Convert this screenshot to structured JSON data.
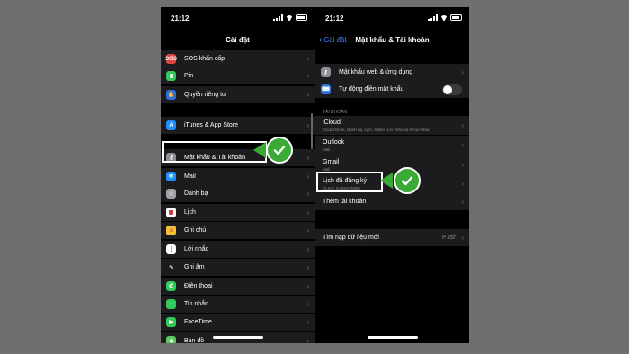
{
  "left_phone": {
    "status": {
      "time": "21:12"
    },
    "title": "Cài đặt",
    "rows": [
      {
        "label": "SOS khẩn cấp",
        "icon": "sos-icon",
        "glyph": "SOS",
        "color": "#e0463d"
      },
      {
        "label": "Pin",
        "icon": "battery-icon",
        "glyph": "▮",
        "color": "#34c759"
      },
      {
        "label": "Quyền riêng tư",
        "icon": "hand-icon",
        "glyph": "✋",
        "color": "#2f6fe0"
      },
      {
        "label": "iTunes & App Store",
        "icon": "app-store-icon",
        "glyph": "A",
        "color": "#1e90ff"
      },
      {
        "label": "Mật khẩu & Tài khoản",
        "icon": "key-icon",
        "glyph": "⚷",
        "color": "#8e8e93"
      },
      {
        "label": "Mail",
        "icon": "mail-icon",
        "glyph": "✉",
        "color": "#1e90ff"
      },
      {
        "label": "Danh bạ",
        "icon": "contacts-icon",
        "glyph": "☺",
        "color": "#a0a0a5"
      },
      {
        "label": "Lịch",
        "icon": "calendar-icon",
        "glyph": "▦",
        "color": "#ffffff"
      },
      {
        "label": "Ghi chú",
        "icon": "notes-icon",
        "glyph": "≡",
        "color": "#f2c233"
      },
      {
        "label": "Lời nhắc",
        "icon": "reminders-icon",
        "glyph": "⋮",
        "color": "#ffffff"
      },
      {
        "label": "Ghi âm",
        "icon": "voice-memos-icon",
        "glyph": "∿",
        "color": "#1c1c1e"
      },
      {
        "label": "Điện thoại",
        "icon": "phone-icon",
        "glyph": "✆",
        "color": "#34c759"
      },
      {
        "label": "Tin nhắn",
        "icon": "messages-icon",
        "glyph": "◌",
        "color": "#34c759"
      },
      {
        "label": "FaceTime",
        "icon": "facetime-icon",
        "glyph": "▶",
        "color": "#34c759"
      },
      {
        "label": "Bản đồ",
        "icon": "maps-icon",
        "glyph": "◆",
        "color": "#5ac85a"
      }
    ]
  },
  "right_phone": {
    "status": {
      "time": "21:12"
    },
    "back_label": "Cài đặt",
    "title": "Mật khẩu & Tài khoản",
    "top_rows": [
      {
        "label": "Mật khẩu web & ứng dụng",
        "icon": "key-icon",
        "glyph": "⚷",
        "color": "#8e8e93"
      },
      {
        "label": "Tự động điền mật khẩu",
        "icon": "keyboard-icon",
        "glyph": "⌨",
        "color": "#2f6fe0"
      }
    ],
    "section_label": "TÀI KHOẢN",
    "accounts": [
      {
        "label": "iCloud",
        "sub": "iCloud Drive, Danh bạ, Lịch, Safari, Lời nhắc và 4 mục khác"
      },
      {
        "label": "Outlook",
        "sub": "Mail"
      },
      {
        "label": "Gmail",
        "sub": "Mail"
      },
      {
        "label": "Lịch đã đăng ký",
        "sub": "CLICK SUBSCRIBE!"
      },
      {
        "label": "Thêm tài khoản",
        "sub": ""
      }
    ],
    "fetch": {
      "label": "Tìm nạp dữ liệu mới",
      "value": "Push"
    }
  },
  "colors": {
    "accent": "#3a86ff",
    "check_green": "#3aaa35"
  }
}
